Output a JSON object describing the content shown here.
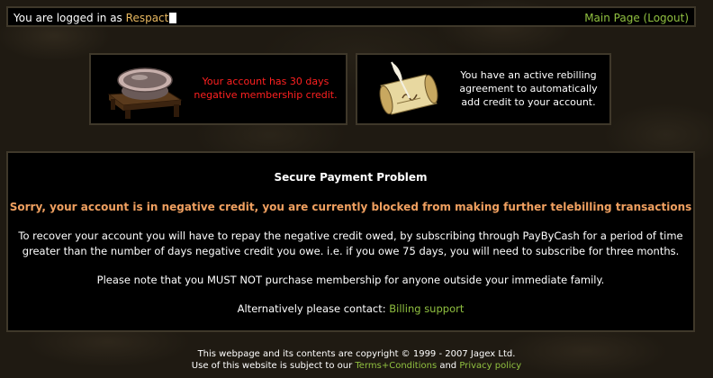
{
  "topbar": {
    "logged_in_prefix": "You are logged in as",
    "username": "Respact",
    "main_page_link": "Main Page",
    "logout_link": "(Logout)"
  },
  "info_boxes": {
    "credit": {
      "icon": "bowl-on-table-icon",
      "text": "Your account has 30 days negative membership credit."
    },
    "rebill": {
      "icon": "scroll-quill-icon",
      "text": "You have an active rebilling agreement to automatically add credit to your account."
    }
  },
  "main": {
    "title": "Secure Payment Problem",
    "warning": "Sorry, your account is in negative credit, you are currently blocked from making further telebilling transactions",
    "paragraph1": "To recover your account you will have to repay the negative credit owed, by subscribing through PayByCash for a period of time greater than the number of days negative credit you owe. i.e. if you owe 75 days, you will need to subscribe for three months.",
    "paragraph2": "Please note that you MUST NOT purchase membership for anyone outside your immediate family.",
    "contact_prefix": "Alternatively please contact:",
    "contact_link": "Billing support"
  },
  "footer": {
    "copyright": "This webpage and its contents are copyright © 1999 - 2007 Jagex Ltd.",
    "use_prefix": "Use of this website is subject to our",
    "terms_link": "Terms+Conditions",
    "and_text": "and",
    "privacy_link": "Privacy policy"
  },
  "colors": {
    "link": "#90c040",
    "username": "#e8b860",
    "warning": "#f0a060",
    "negative_credit": "#ff2020",
    "box_border": "#3f382a"
  }
}
